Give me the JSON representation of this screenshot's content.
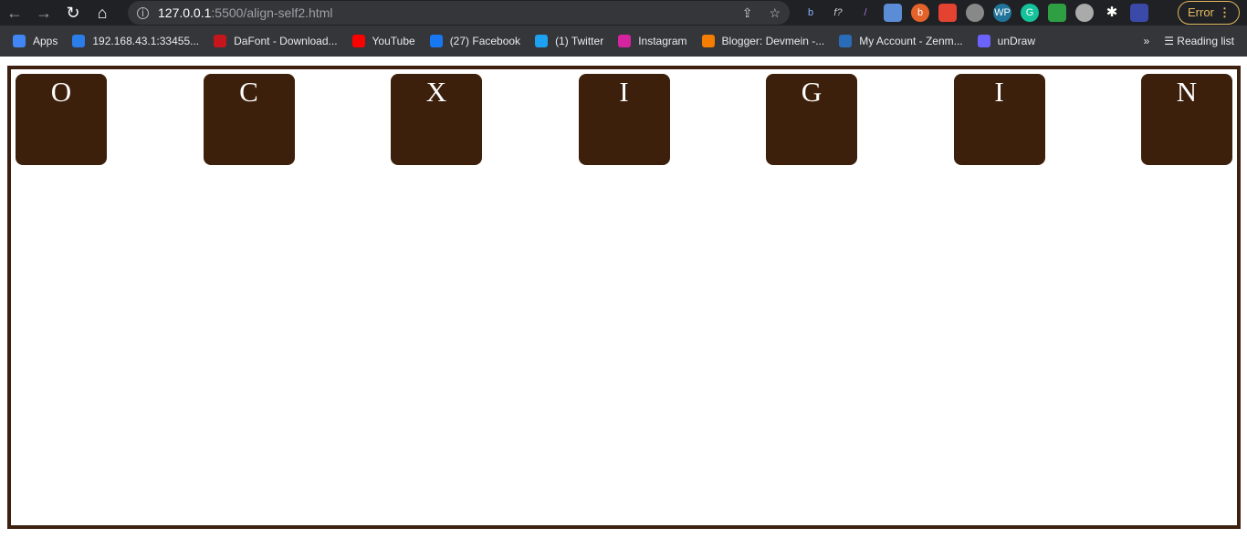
{
  "browser": {
    "url_host": "127.0.0.1",
    "url_path": ":5500/align-self2.html",
    "error_label": "Error",
    "bookmarks": [
      {
        "label": "Apps",
        "color": "#4285f4"
      },
      {
        "label": "192.168.43.1:33455...",
        "color": "#2b7de9"
      },
      {
        "label": "DaFont - Download...",
        "color": "#c4161c"
      },
      {
        "label": "YouTube",
        "color": "#ff0000"
      },
      {
        "label": "(27) Facebook",
        "color": "#1877f2"
      },
      {
        "label": "(1) Twitter",
        "color": "#1da1f2"
      },
      {
        "label": "Instagram",
        "color": "#d6249f"
      },
      {
        "label": "Blogger: Devmein -...",
        "color": "#f57d00"
      },
      {
        "label": "My Account - Zenm...",
        "color": "#2a6cb8"
      },
      {
        "label": "unDraw",
        "color": "#6c63ff"
      }
    ],
    "more_label": "»",
    "reading_list": "Reading list"
  },
  "page": {
    "letters": [
      "O",
      "C",
      "X",
      "I",
      "G",
      "I",
      "N"
    ],
    "box_color": "#3d200c",
    "border_color": "#3d2010"
  }
}
